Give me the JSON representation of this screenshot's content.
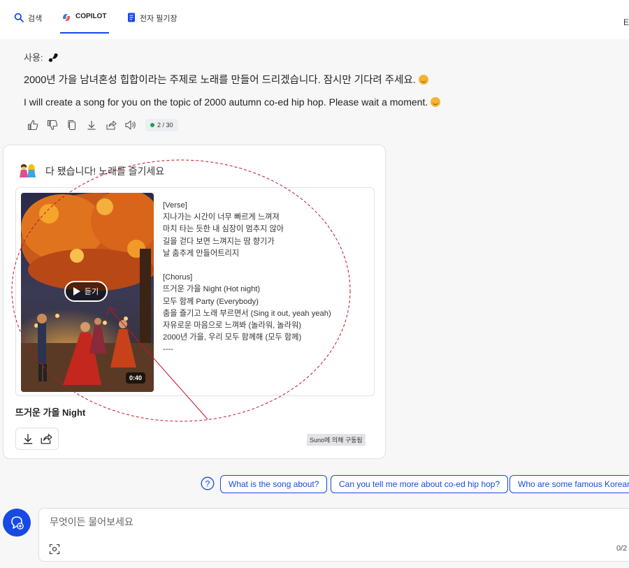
{
  "tabs": [
    {
      "label": "검색",
      "icon": "search-icon"
    },
    {
      "label": "COPILOT",
      "icon": "copilot-logo-icon",
      "active": true
    },
    {
      "label": "전자 필기장",
      "icon": "notebook-icon"
    }
  ],
  "edge_letter": "E",
  "user_line": {
    "label": "사용:",
    "plugin_icon": "suno-logo-icon"
  },
  "messages": {
    "korean": "2000년 가을 남녀혼성 힙합이라는 주제로 노래를 만들어 드리겠습니다. 잠시만 기다려 주세요.",
    "english": "I will create a song for you on the topic of 2000 autumn co-ed hip hop. Please wait a moment."
  },
  "actions": [
    "thumbs-up-icon",
    "thumbs-down-icon",
    "copy-icon",
    "download-icon",
    "share-icon",
    "speaker-icon"
  ],
  "counter": "2 / 30",
  "card": {
    "header": "다 됐습니다! 노래를 즐기세요",
    "play_label": "듣기",
    "duration": "0:40",
    "lyrics": "[Verse]\n지나가는 시간이 너무 빠르게 느껴져\n마치 타는 듯한 내 심장이 멈추지 않아\n길을 걷다 보면 느껴지는 땀 향기가\n날 춤추게 만들어트리지\n\n[Chorus]\n뜨거운 가을 Night (Hot night)\n모두 함께 Party (Everybody)\n춤을 즐기고 노래 부르면서 (Sing it out, yeah yeah)\n자유로운 마음으로 느껴봐 (놀라워, 놀라워)\n2000년 가을, 우리 모두 함께해 (모두 함께)\n----",
    "song_title": "뜨거운 가을 Night",
    "powered_by": "Suno에 의해 구동됨"
  },
  "suggestions": [
    "What is the song about?",
    "Can you tell me more about co-ed hip hop?",
    "Who are some famous Korean"
  ],
  "input": {
    "placeholder": "무엇이든 물어보세요",
    "value": "",
    "char_count": "0/2"
  },
  "colors": {
    "accent": "#174ae4",
    "annotation": "#c8102e"
  }
}
